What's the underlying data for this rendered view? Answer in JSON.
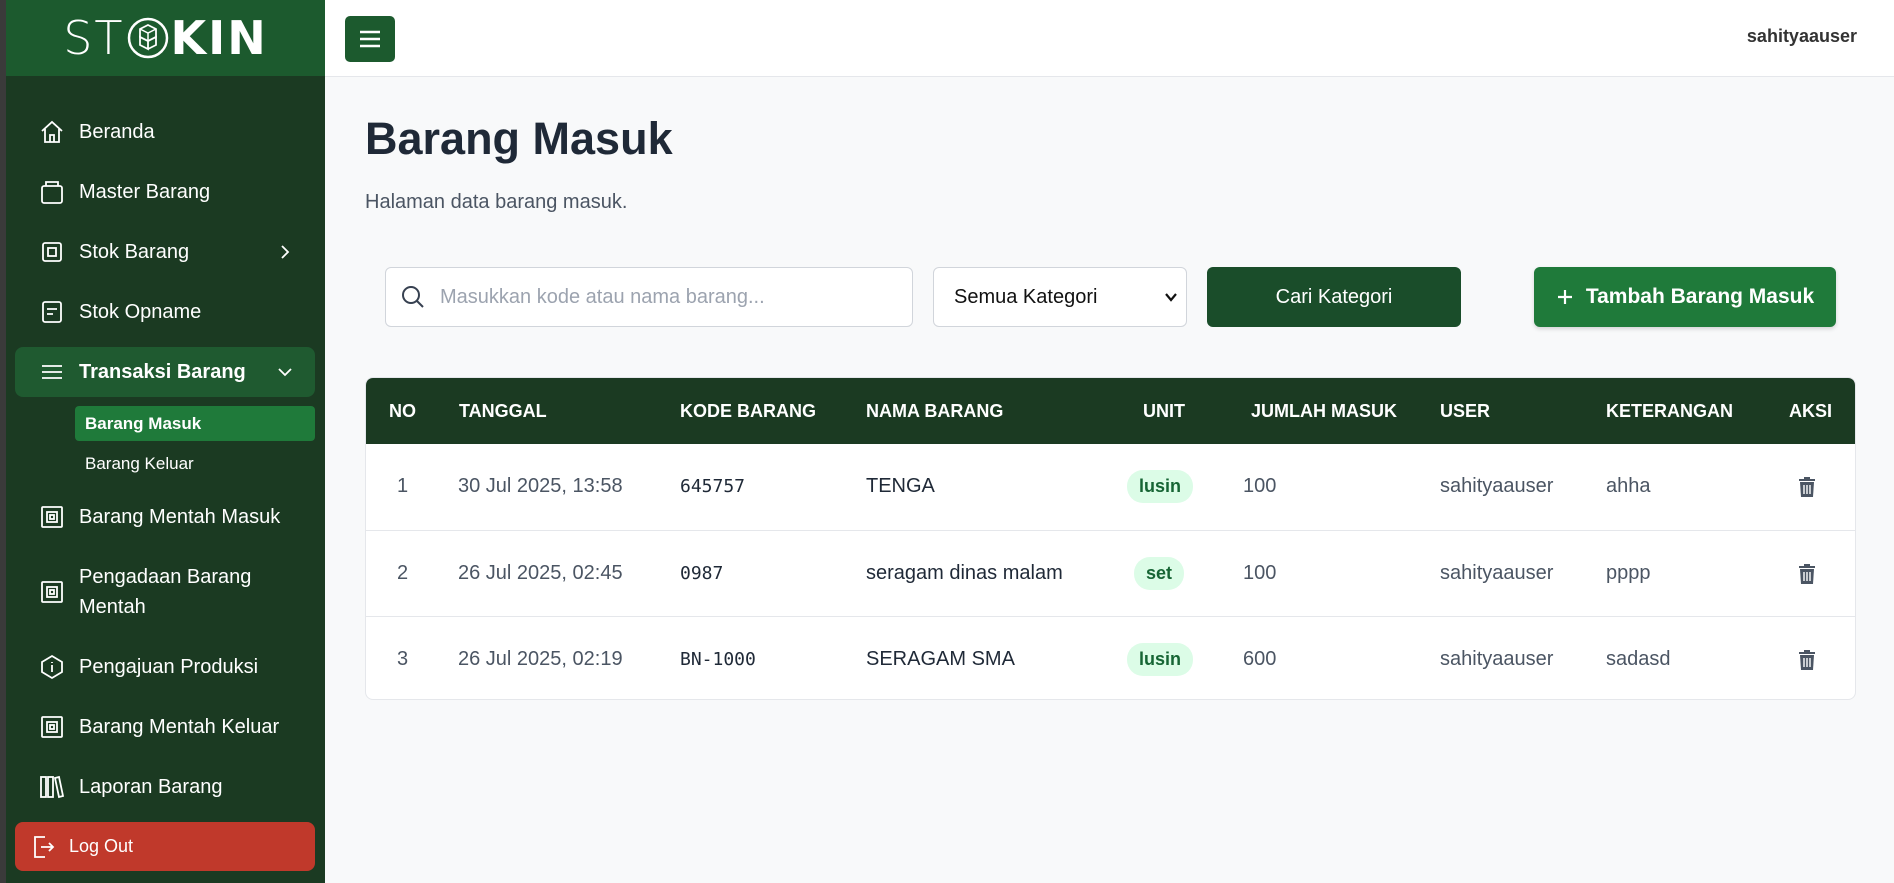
{
  "sidebar": {
    "logo": {
      "part1": "ST",
      "part2": "K",
      "part3": "IN"
    },
    "items": [
      {
        "label": "Beranda",
        "icon": "home-icon"
      },
      {
        "label": "Master Barang",
        "icon": "box-icon"
      },
      {
        "label": "Stok Barang",
        "icon": "square-icon"
      },
      {
        "label": "Stok Opname",
        "icon": "document-icon"
      },
      {
        "label": "Transaksi Barang",
        "icon": "list-icon"
      },
      {
        "label": "Barang Mentah Masuk",
        "icon": "square-icon"
      },
      {
        "label": "Pengadaan Barang Mentah",
        "icon": "square-icon"
      },
      {
        "label": "Pengajuan Produksi",
        "icon": "info-icon"
      },
      {
        "label": "Barang Mentah Keluar",
        "icon": "square-icon"
      },
      {
        "label": "Laporan Barang",
        "icon": "library-icon"
      }
    ],
    "subitems": [
      {
        "label": "Barang Masuk"
      },
      {
        "label": "Barang Keluar"
      }
    ],
    "logout_label": "Log Out"
  },
  "header": {
    "username": "sahityaauser"
  },
  "main": {
    "title": "Barang Masuk",
    "subtitle": "Halaman data barang masuk.",
    "search_placeholder": "Masukkan kode atau nama barang...",
    "category_selected": "Semua Kategori",
    "search_button": "Cari Kategori",
    "add_button": "Tambah Barang Masuk"
  },
  "table": {
    "headers": [
      "NO",
      "TANGGAL",
      "KODE BARANG",
      "NAMA BARANG",
      "UNIT",
      "JUMLAH MASUK",
      "USER",
      "KETERANGAN",
      "AKSI"
    ],
    "rows": [
      {
        "no": "1",
        "tanggal": "30 Jul 2025, 13:58",
        "kode": "645757",
        "nama": "TENGA",
        "unit": "lusin",
        "jumlah": "100",
        "user": "sahityaauser",
        "keterangan": "ahha"
      },
      {
        "no": "2",
        "tanggal": "26 Jul 2025, 02:45",
        "kode": "0987",
        "nama": "seragam dinas malam",
        "unit": "set",
        "jumlah": "100",
        "user": "sahityaauser",
        "keterangan": "pppp"
      },
      {
        "no": "3",
        "tanggal": "26 Jul 2025, 02:19",
        "kode": "BN-1000",
        "nama": "SERAGAM SMA",
        "unit": "lusin",
        "jumlah": "600",
        "user": "sahityaauser",
        "keterangan": "sadasd"
      }
    ]
  },
  "colors": {
    "sidebar_bg": "#1b3a22",
    "accent_green": "#1f7a3a",
    "logout_red": "#c0392b",
    "badge_bg": "#dcfce7"
  }
}
